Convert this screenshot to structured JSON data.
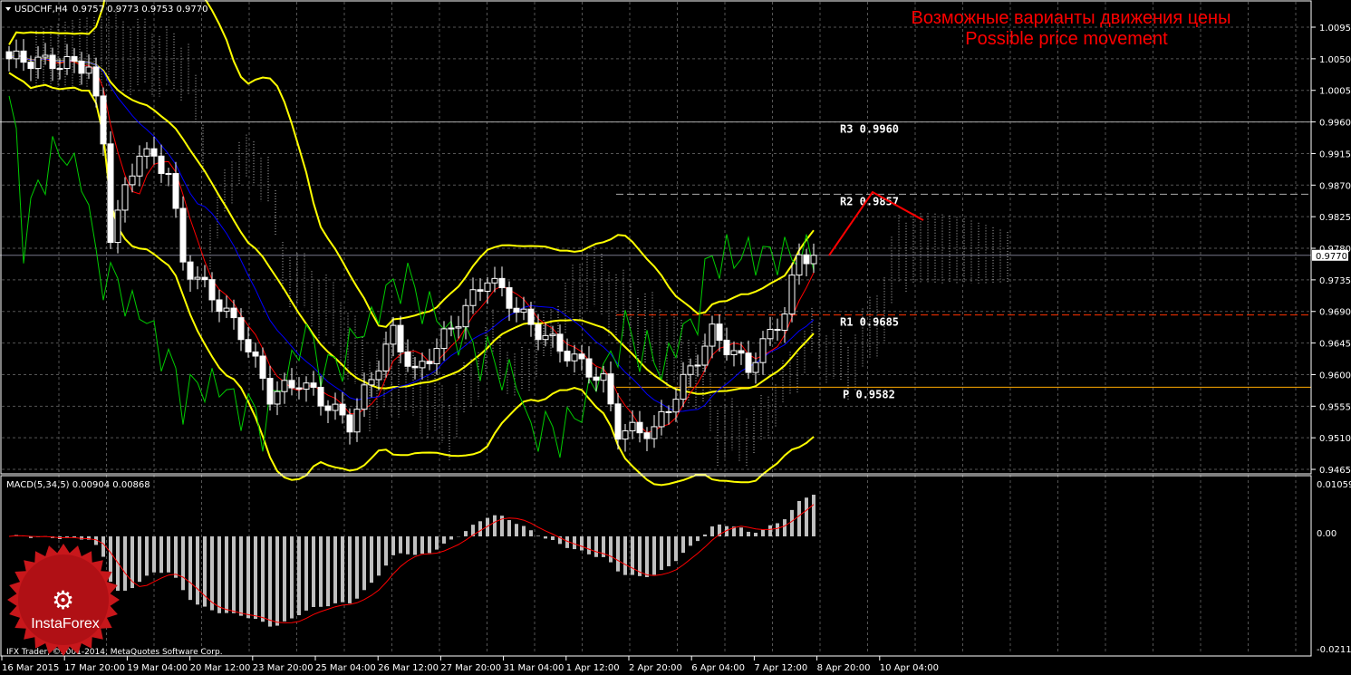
{
  "header": {
    "symbol": "USDCHF,H4",
    "ohlc": "0.9757 0.9773 0.9753 0.9770"
  },
  "annotation": {
    "line1": "Возможные варианты движения цены",
    "line2": "Possible price movement"
  },
  "macd": {
    "label": "MACD(5,34,5) 0.00904 0.00868",
    "ticks": [
      "0.01059",
      "0.00",
      "-0.02111"
    ]
  },
  "copyright": "IFX Trader, ©2001-2014, MetaQuotes Software Corp.",
  "logo": {
    "text": "InstaForex"
  },
  "colors": {
    "bg": "#000000",
    "bull": "#ffffff",
    "bear": "#ffffff",
    "bollinger": "#ffff00",
    "red_ma": "#ff0000",
    "blue_ma": "#0000ff",
    "green": "#00cc00",
    "forecast": "#ff0000"
  },
  "chart_data": {
    "type": "candlestick",
    "title": "USDCHF,H4",
    "ylim": [
      0.9465,
      1.0095
    ],
    "y_ticks": [
      "1.0095",
      "1.0050",
      "1.0005",
      "0.9960",
      "0.9915",
      "0.9870",
      "0.9825",
      "0.9780",
      "0.9735",
      "0.9690",
      "0.9645",
      "0.9600",
      "0.9555",
      "0.9510",
      "0.9465"
    ],
    "x_ticks": [
      "16 Mar 2015",
      "17 Mar 20:00",
      "19 Mar 04:00",
      "20 Mar 12:00",
      "23 Mar 20:00",
      "25 Mar 04:00",
      "26 Mar 12:00",
      "27 Mar 20:00",
      "31 Mar 04:00",
      "1 Apr 12:00",
      "2 Apr 20:00",
      "6 Apr 04:00",
      "7 Apr 12:00",
      "8 Apr 20:00",
      "10 Apr 04:00"
    ],
    "current_price": "0.9770",
    "price_path": [
      [
        0,
        1.005
      ],
      [
        11,
        1.004
      ],
      [
        13,
        0.993
      ],
      [
        14,
        0.98
      ],
      [
        18,
        0.992
      ],
      [
        22,
        0.989
      ],
      [
        24,
        0.976
      ],
      [
        29,
        0.97
      ],
      [
        32,
        0.966
      ],
      [
        36,
        0.957
      ],
      [
        40,
        0.959
      ],
      [
        47,
        0.953
      ],
      [
        53,
        0.966
      ],
      [
        56,
        0.96
      ],
      [
        62,
        0.968
      ],
      [
        66,
        0.974
      ],
      [
        72,
        0.967
      ],
      [
        77,
        0.963
      ],
      [
        82,
        0.959
      ],
      [
        84,
        0.952
      ],
      [
        89,
        0.952
      ],
      [
        93,
        0.959
      ],
      [
        97,
        0.966
      ],
      [
        102,
        0.961
      ],
      [
        107,
        0.969
      ],
      [
        109,
        0.977
      ],
      [
        112,
        0.977
      ]
    ],
    "levels": [
      {
        "name": "R3",
        "label": "R3  0.9960",
        "value": 0.996,
        "color": "#aaaaaa",
        "style": "solid"
      },
      {
        "name": "R2",
        "label": "R2  0.9857",
        "value": 0.9857,
        "color": "#aaaaaa",
        "style": "dashed"
      },
      {
        "name": "R1",
        "label": "R1  0.9685",
        "value": 0.9685,
        "color": "#ff3300",
        "style": "dashed"
      },
      {
        "name": "P",
        "label": "P  0.9582",
        "value": 0.9582,
        "color": "#ffaa00",
        "style": "solid"
      }
    ],
    "forecast": [
      [
        0.977,
        0
      ],
      [
        0.986,
        6
      ],
      [
        0.982,
        13
      ]
    ]
  }
}
